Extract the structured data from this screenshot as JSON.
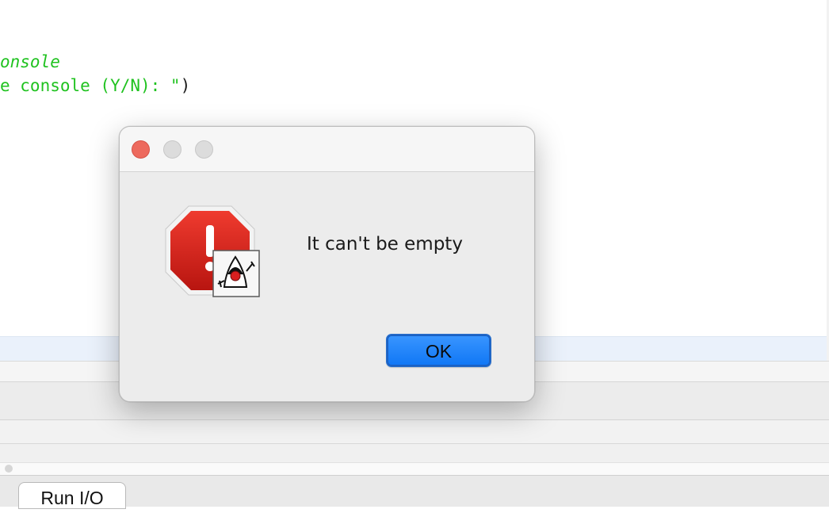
{
  "editor": {
    "code_lines": [
      {
        "text": "onsole",
        "italic": true
      },
      {
        "text": "e console (Y/N): \"",
        "closing_paren": ")"
      }
    ]
  },
  "dialog": {
    "message": "It can't be empty",
    "ok_label": "OK",
    "icon": "error-stop-sign-with-java-duke-icon"
  },
  "bottom_tabs": {
    "run_io_label": "Run I/O"
  },
  "colors": {
    "code_string": "#1fc21f",
    "ok_button": "#0f76f5",
    "close_button": "#ed6a5e",
    "error_red": "#d3231b"
  }
}
